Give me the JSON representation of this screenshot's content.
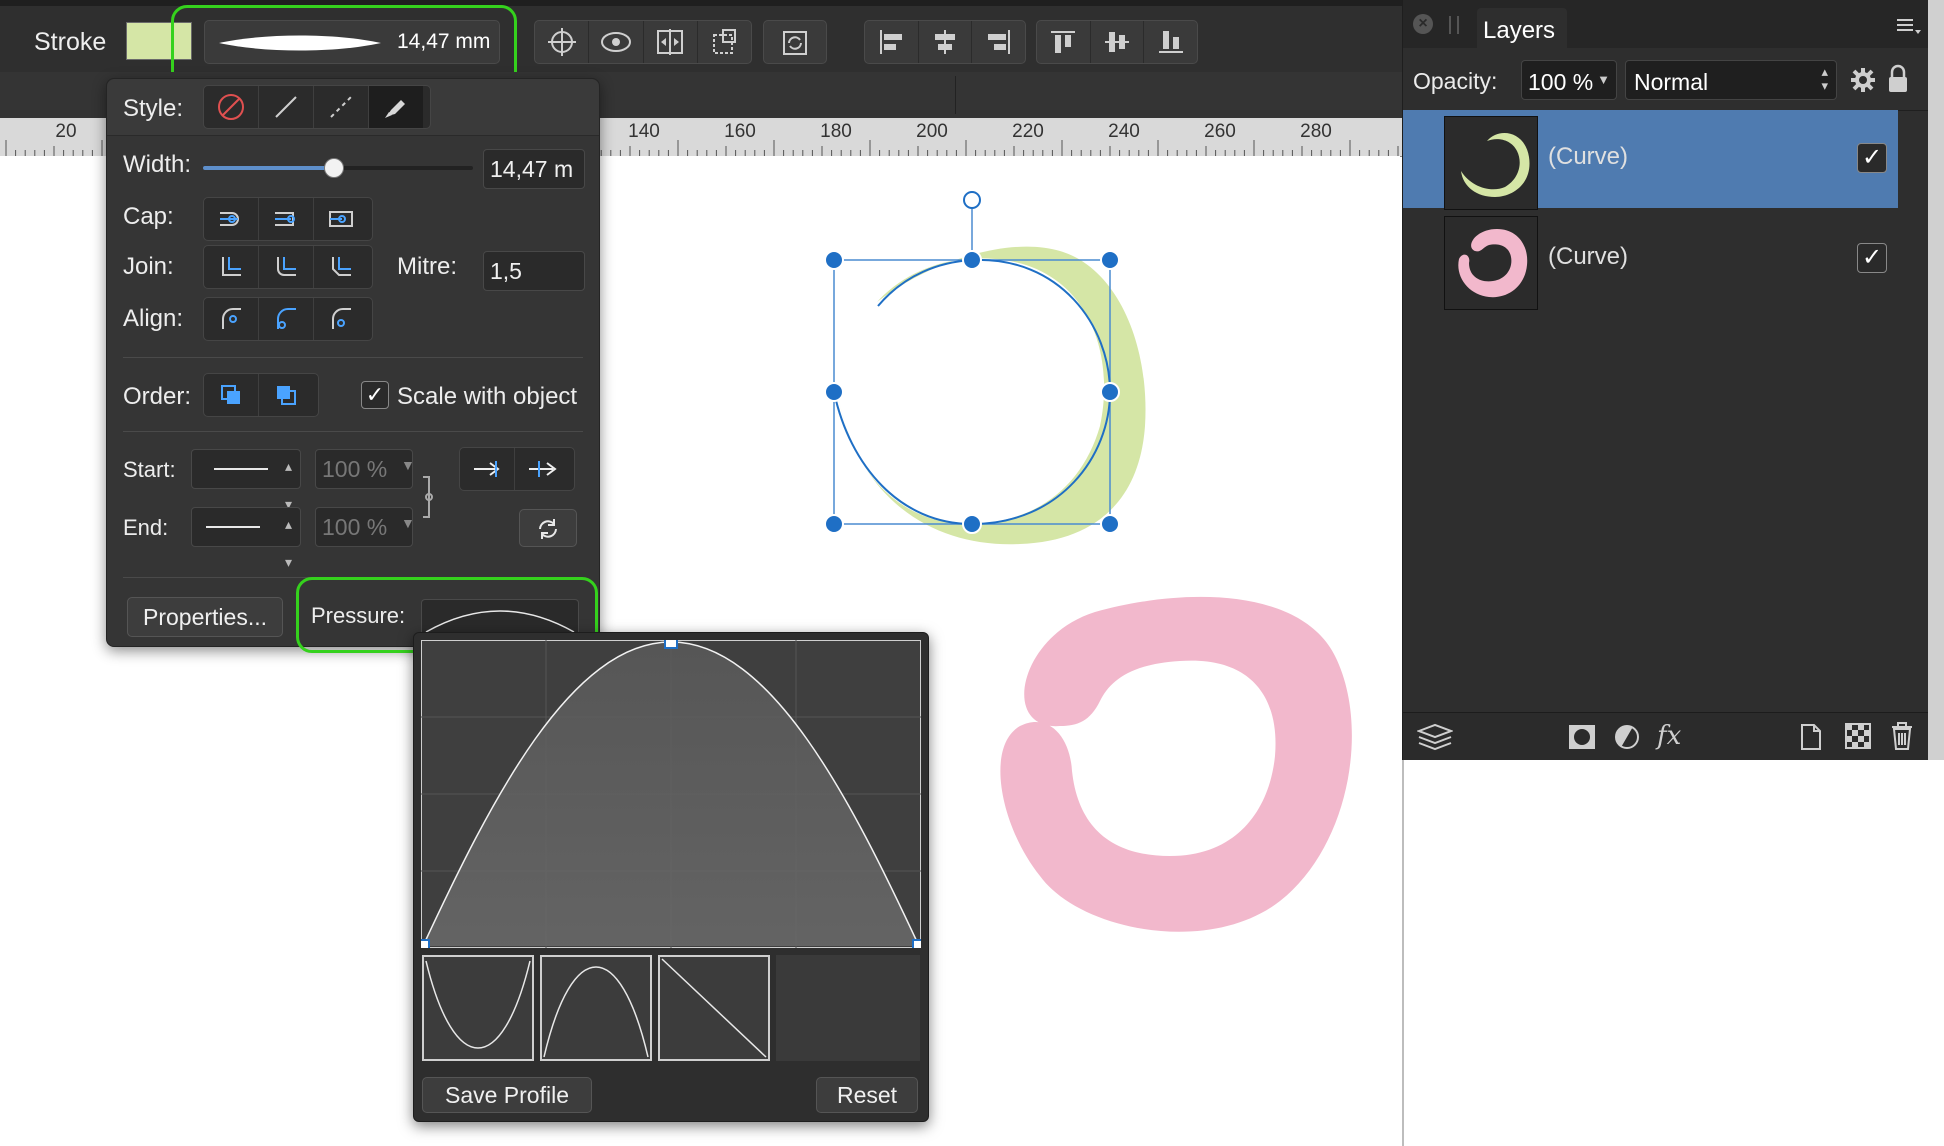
{
  "toolbar": {
    "stroke_label": "Stroke",
    "stroke_color": "#d5e6a6",
    "width_value": "14,47 mm",
    "highlight_color": "#35d11d"
  },
  "ruler": {
    "labels": [
      "20",
      "140",
      "160",
      "180",
      "200",
      "220",
      "240",
      "260",
      "280"
    ]
  },
  "stroke_panel": {
    "style_label": "Style:",
    "width_label": "Width:",
    "width_value": "14,47 m",
    "width_slider_fraction": 0.48,
    "cap_label": "Cap:",
    "join_label": "Join:",
    "mitre_label": "Mitre:",
    "mitre_value": "1,5",
    "align_label": "Align:",
    "order_label": "Order:",
    "scale_label": "Scale with object",
    "scale_checked": true,
    "start_label": "Start:",
    "end_label": "End:",
    "start_percent": "100 %",
    "end_percent": "100 %",
    "properties_button": "Properties...",
    "pressure_label": "Pressure:"
  },
  "pressure_popup": {
    "save_button": "Save Profile",
    "reset_button": "Reset"
  },
  "layers": {
    "tab_title": "Layers",
    "opacity_label": "Opacity:",
    "opacity_value": "100 %",
    "blend_mode": "Normal",
    "items": [
      {
        "name": "(Curve)",
        "selected": true,
        "visible": true,
        "color": "#d5e6a6"
      },
      {
        "name": "(Curve)",
        "selected": false,
        "visible": true,
        "color": "#f2b8cc"
      }
    ],
    "selected_color": "#4f7bb0"
  },
  "canvas": {
    "green_shape_color": "#d5e6a6",
    "pink_shape_color": "#f2b8cc",
    "selection_color": "#1f6fc5"
  }
}
